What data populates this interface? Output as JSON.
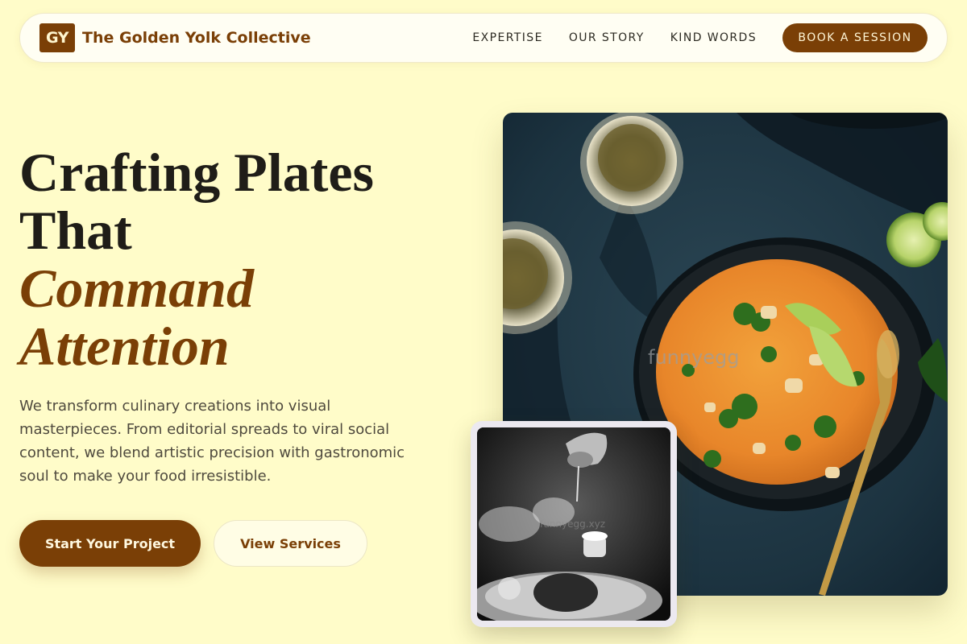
{
  "brand": {
    "monogram": "GY",
    "name": "The Golden Yolk Collective"
  },
  "nav": {
    "links": [
      "EXPERTISE",
      "OUR STORY",
      "KIND WORDS"
    ],
    "cta": "BOOK A SESSION"
  },
  "hero": {
    "headline_line1": "Crafting Plates",
    "headline_line2": "That",
    "headline_accent1": "Command",
    "headline_accent2": "Attention",
    "lead": "We transform culinary creations into visual masterpieces. From editorial spreads to viral social content, we blend artistic precision with gastronomic soul to make your food irresistible.",
    "primary_button": "Start Your Project",
    "secondary_button": "View Services"
  },
  "images": {
    "main_watermark": "funnyegg",
    "inset_watermark": "funnyegg.xyz"
  },
  "colors": {
    "background": "#fffcc9",
    "brand_brown": "#7a3f06",
    "text_dark": "#1f1d18",
    "text_muted": "#4f4a3e"
  }
}
